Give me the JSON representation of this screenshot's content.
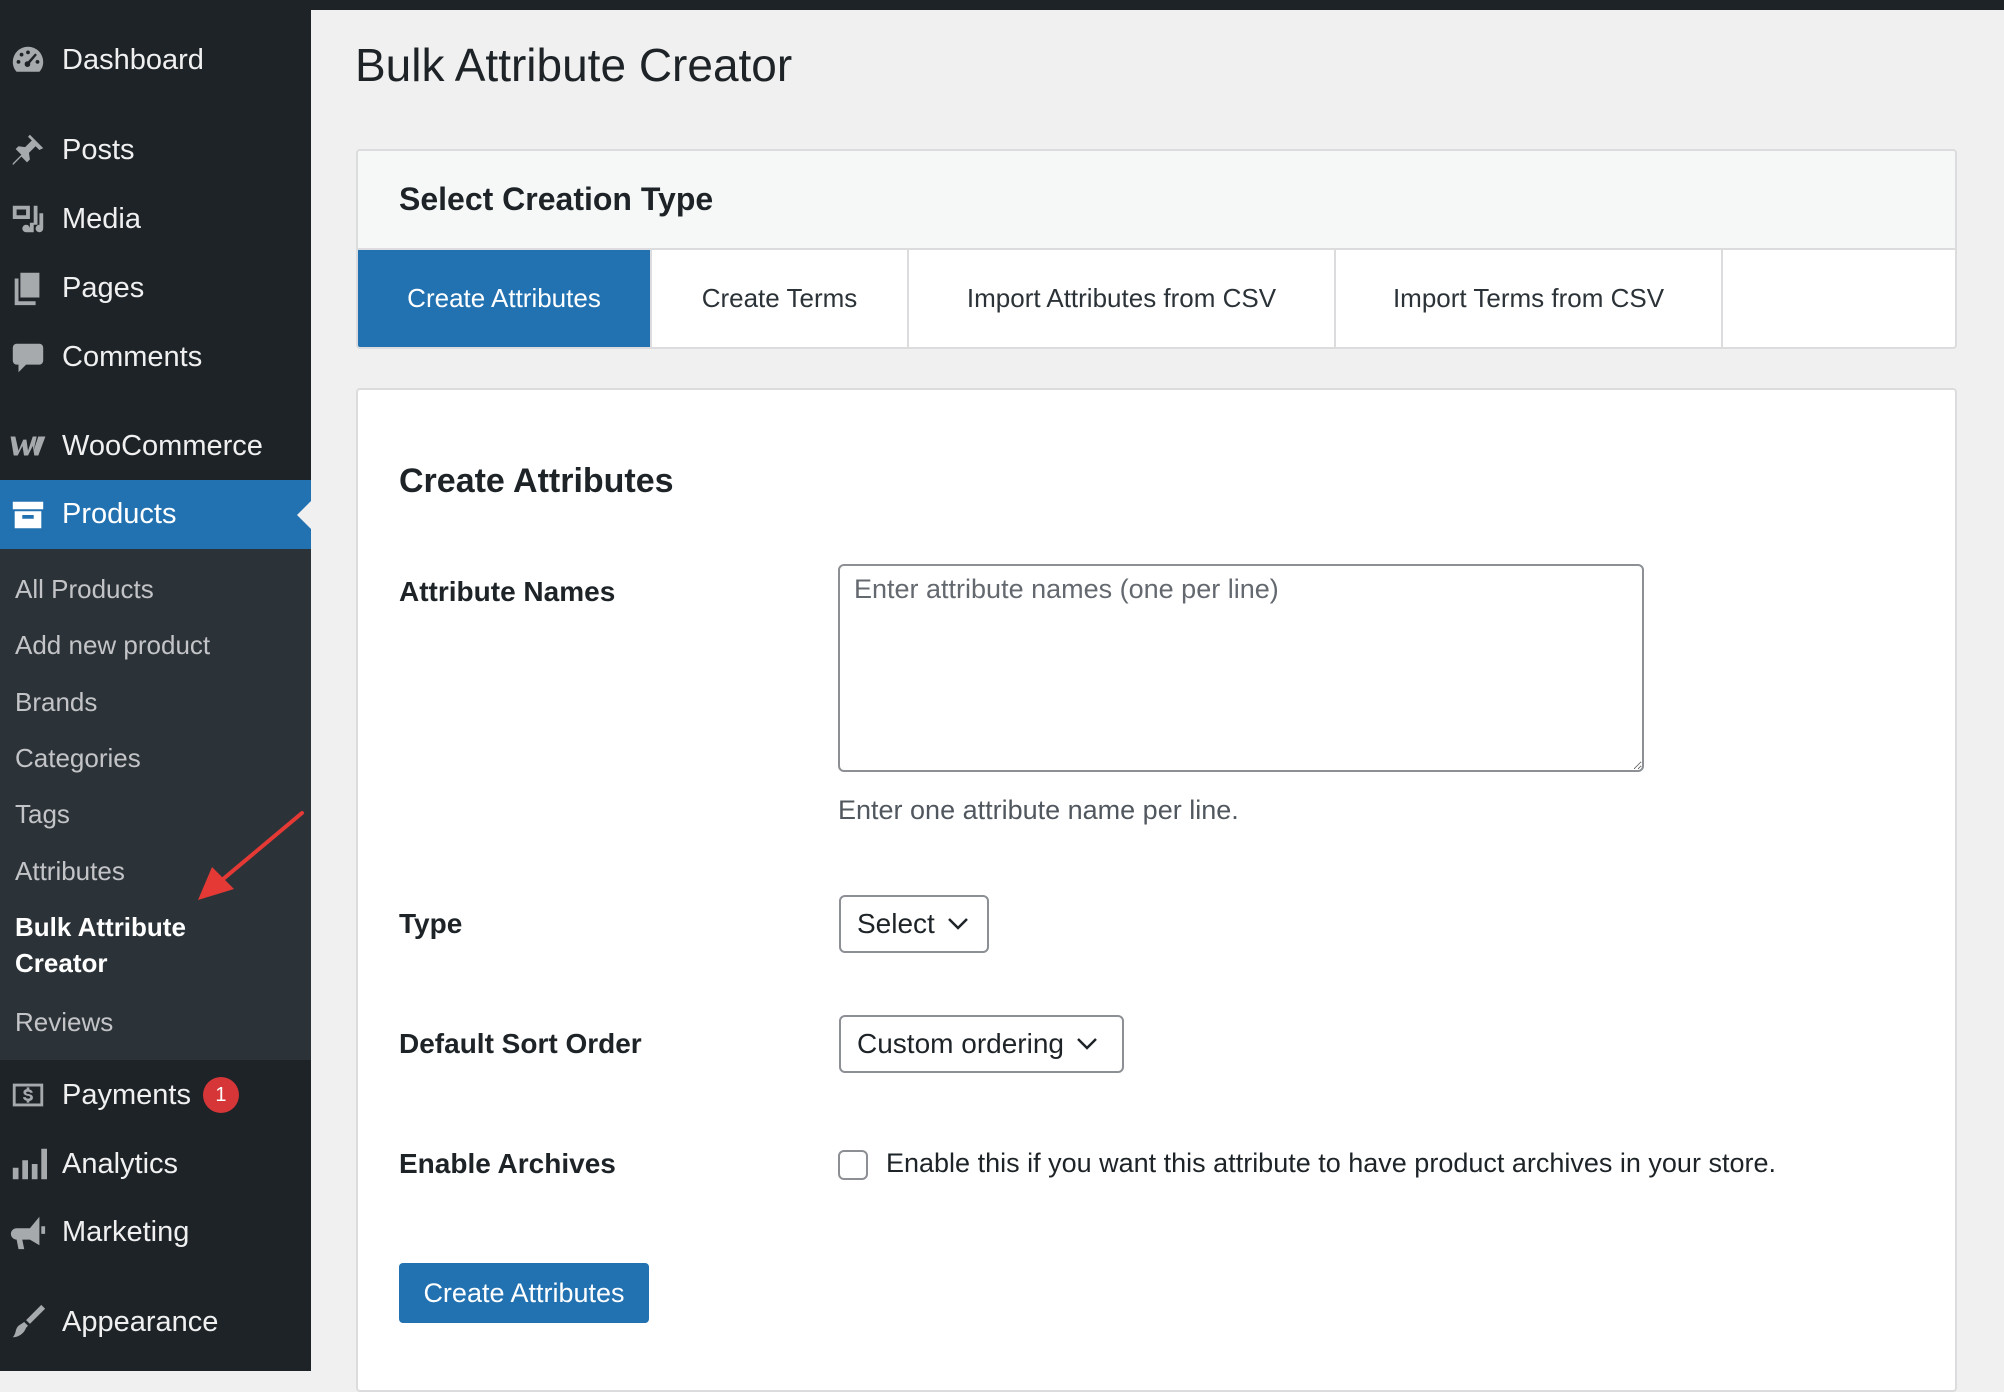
{
  "sidebar": {
    "items": [
      {
        "label": "Dashboard",
        "icon": "dashboard-icon"
      },
      {
        "label": "Posts",
        "icon": "pin-icon"
      },
      {
        "label": "Media",
        "icon": "media-icon"
      },
      {
        "label": "Pages",
        "icon": "pages-icon"
      },
      {
        "label": "Comments",
        "icon": "comment-icon"
      },
      {
        "label": "WooCommerce",
        "icon": "woocommerce-icon"
      },
      {
        "label": "Products",
        "icon": "archive-icon",
        "active": true
      },
      {
        "label": "Payments",
        "icon": "dollar-icon",
        "badge": "1"
      },
      {
        "label": "Analytics",
        "icon": "bar-chart-icon"
      },
      {
        "label": "Marketing",
        "icon": "megaphone-icon"
      },
      {
        "label": "Appearance",
        "icon": "brush-icon"
      }
    ],
    "submenu": [
      "All Products",
      "Add new product",
      "Brands",
      "Categories",
      "Tags",
      "Attributes",
      "Bulk Attribute Creator",
      "Reviews"
    ]
  },
  "page": {
    "title": "Bulk Attribute Creator"
  },
  "tabs_card": {
    "heading": "Select Creation Type",
    "tabs": [
      {
        "label": "Create Attributes",
        "active": true
      },
      {
        "label": "Create Terms"
      },
      {
        "label": "Import Attributes from CSV"
      },
      {
        "label": "Import Terms from CSV"
      }
    ]
  },
  "form": {
    "heading": "Create Attributes",
    "names_label": "Attribute Names",
    "names_placeholder": "Enter attribute names (one per line)",
    "names_help": "Enter one attribute name per line.",
    "type_label": "Type",
    "type_value": "Select",
    "sort_label": "Default Sort Order",
    "sort_value": "Custom ordering",
    "archives_label": "Enable Archives",
    "archives_checkbox_label": "Enable this if you want this attribute to have product archives in your store.",
    "submit_label": "Create Attributes"
  },
  "colors": {
    "sidebar_bg": "#1d2327",
    "submenu_bg": "#2c3338",
    "accent": "#2271b1",
    "badge": "#d63638",
    "annotation_arrow": "#e53935"
  }
}
